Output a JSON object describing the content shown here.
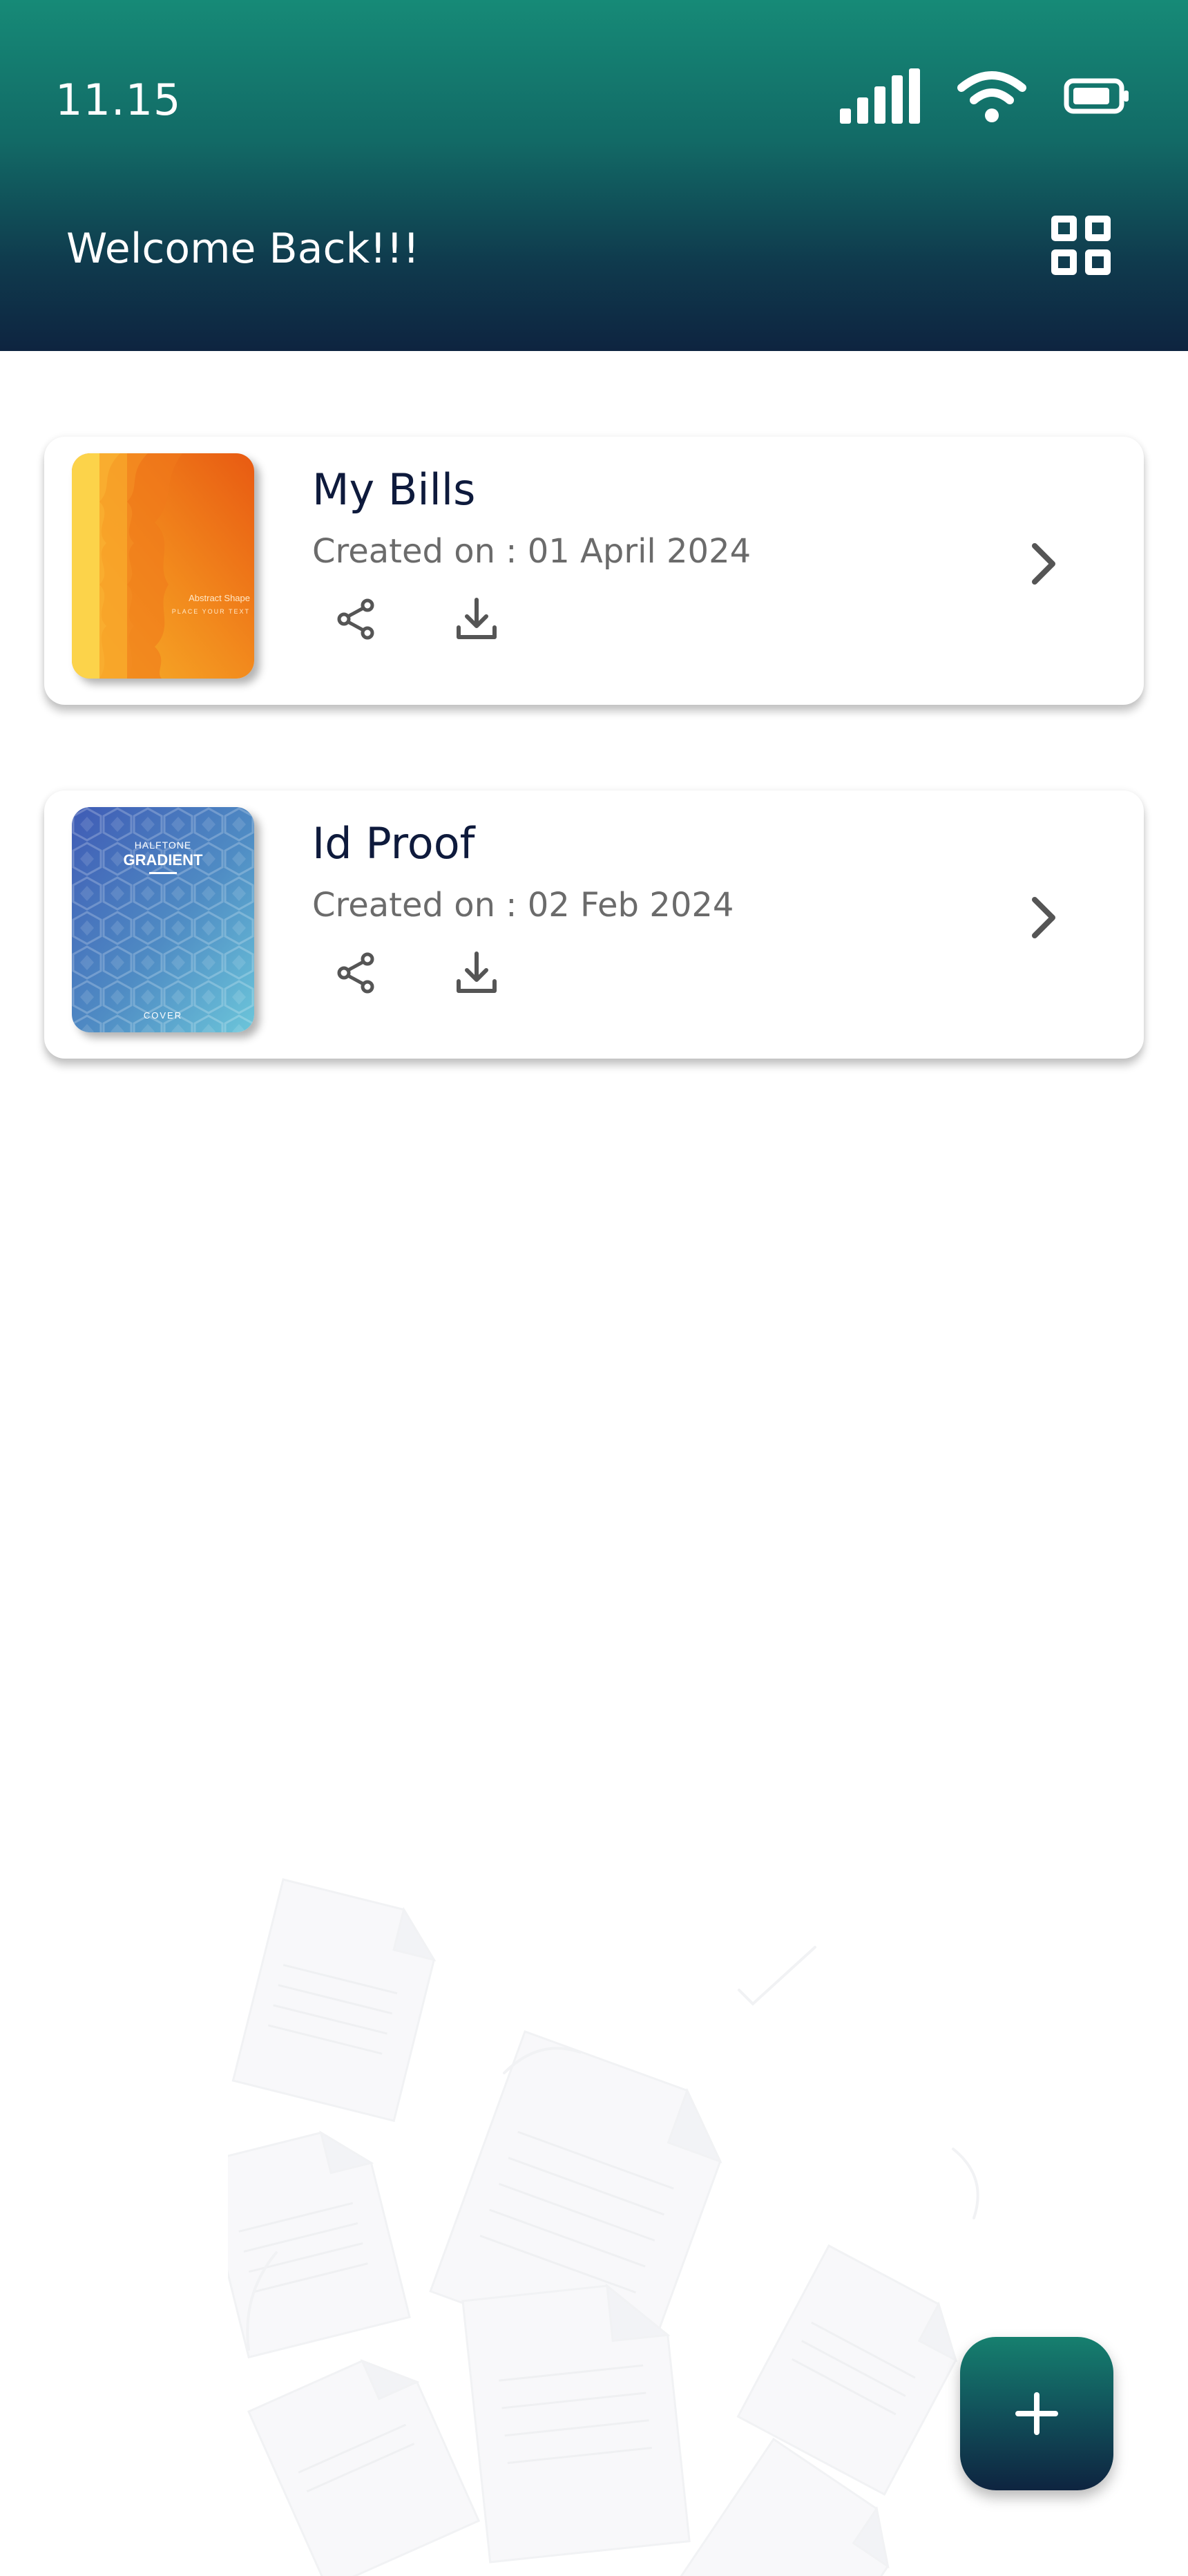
{
  "status_bar": {
    "time": "11.15",
    "icons": [
      "signal-icon",
      "wifi-icon",
      "battery-icon"
    ]
  },
  "header": {
    "welcome": "Welcome Back!!!",
    "view_toggle_icon": "grid-view-icon"
  },
  "documents": [
    {
      "title": "My Bills",
      "created": "Created on : 01 April 2024",
      "thumbnail": "orange-cover",
      "thumbnail_text": [
        "Abstract Shape",
        "PLACE YOUR TEXT"
      ],
      "actions": [
        "share-icon",
        "download-icon"
      ]
    },
    {
      "title": "Id Proof",
      "created": "Created on : 02 Feb 2024",
      "thumbnail": "blue-halftone-cover",
      "thumbnail_text": [
        "HALFTONE",
        "GRADIENT",
        "COVER"
      ],
      "actions": [
        "share-icon",
        "download-icon"
      ]
    }
  ],
  "fab": {
    "icon": "plus-icon"
  },
  "colors": {
    "header_top": "#168a77",
    "header_bottom": "#0e2440",
    "title_text": "#0e1a3c",
    "muted_text": "#6b6b6b"
  }
}
